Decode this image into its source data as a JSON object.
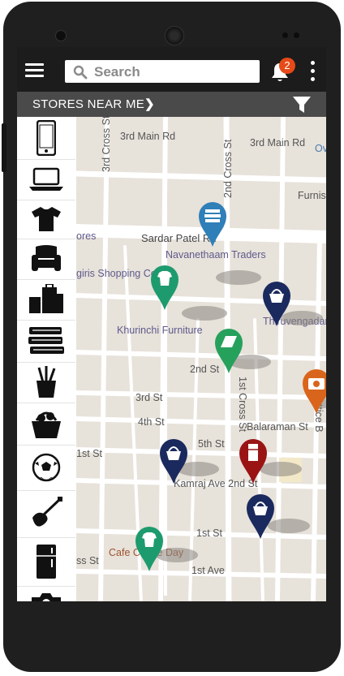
{
  "header": {
    "search_placeholder": "Search",
    "notification_count": "2"
  },
  "subheader": {
    "title": "STORES NEAR ME"
  },
  "categories": [
    {
      "icon": "smartphone-icon"
    },
    {
      "icon": "laptop-icon"
    },
    {
      "icon": "tshirt-icon"
    },
    {
      "icon": "armchair-icon"
    },
    {
      "icon": "luggage-icon"
    },
    {
      "icon": "books-icon"
    },
    {
      "icon": "stationery-icon"
    },
    {
      "icon": "grocery-basket-icon"
    },
    {
      "icon": "football-icon"
    },
    {
      "icon": "guitar-icon"
    },
    {
      "icon": "refrigerator-icon"
    },
    {
      "icon": "camera-icon"
    }
  ],
  "map": {
    "roads": [
      "3rd Main Rd",
      "3rd Main Rd",
      "3rd Cross St",
      "2nd Cross St",
      "Sardar Patel Rd",
      "1st Cross St",
      "2nd St",
      "3rd St",
      "4th St",
      "5th St",
      "1st St",
      "Balaraman St",
      "Kamraj Ave 2nd St",
      "1st St",
      "1st Ave",
      "ss St",
      "Lattice B",
      "Ov",
      "Furnis"
    ],
    "places": [
      "Navanethaam Traders",
      "giris Shopping Ce",
      "Khurinchi Furniture",
      "Thiruvengadam S",
      "ores",
      "Cafe Coffee Day"
    ]
  },
  "pins": [
    {
      "category": "books",
      "color": "#2f7fb8"
    },
    {
      "category": "clothing",
      "color": "#1e9b6e"
    },
    {
      "category": "grocery",
      "color": "#1a2a5e"
    },
    {
      "category": "laptops",
      "color": "#26a15c"
    },
    {
      "category": "camera",
      "color": "#d9651c"
    },
    {
      "category": "grocery",
      "color": "#1a2a5e"
    },
    {
      "category": "refrigerator",
      "color": "#9a1414"
    },
    {
      "category": "grocery",
      "color": "#1a2a5e"
    },
    {
      "category": "clothing",
      "color": "#1e9b6e"
    }
  ]
}
